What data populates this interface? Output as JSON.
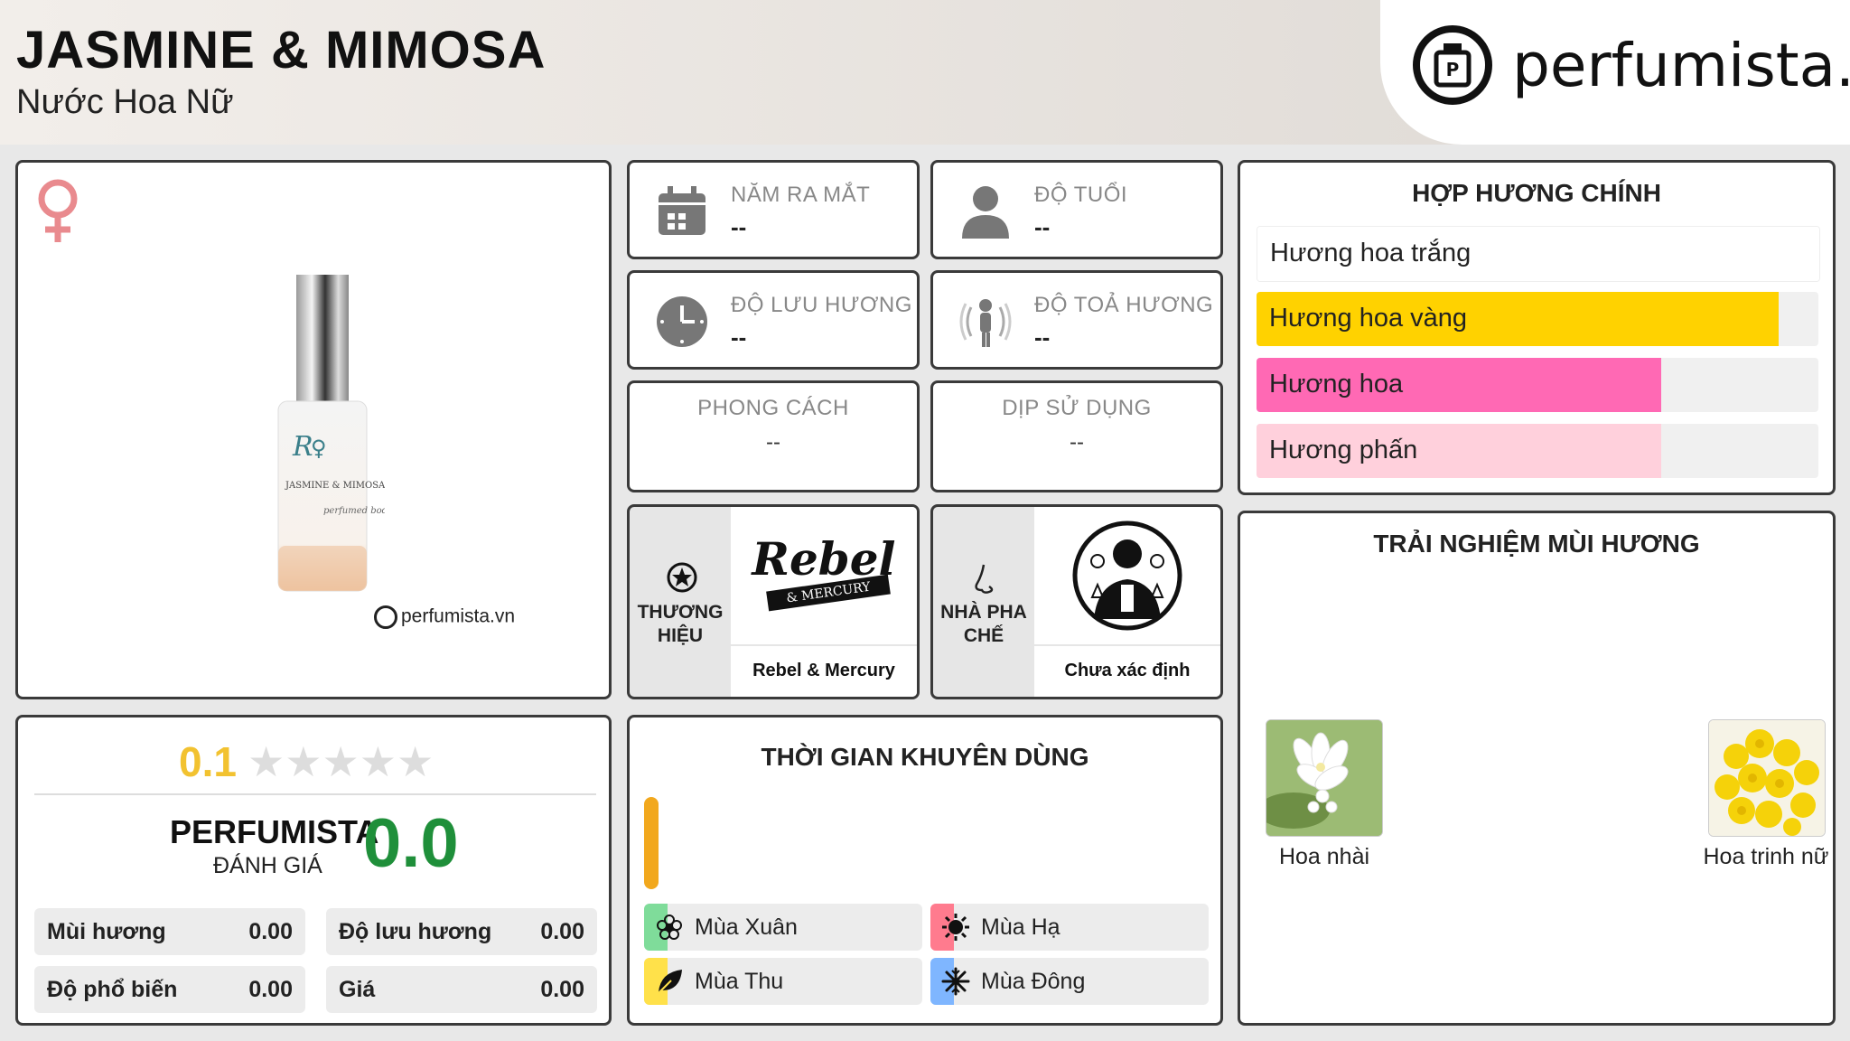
{
  "header": {
    "title": "JASMINE & MIMOSA",
    "subtitle": "Nước Hoa Nữ",
    "logo_text": "perfumista.vn"
  },
  "product": {
    "gender_icon": "female-symbol-icon",
    "watermark": "perfumista.vn",
    "bottle_label_line1": "JASMINE & MIMOSA",
    "bottle_label_line2": "perfumed body"
  },
  "info": {
    "release_year": {
      "label": "NĂM RA MẮT",
      "value": "--"
    },
    "age": {
      "label": "ĐỘ TUỔI",
      "value": "--"
    },
    "longevity": {
      "label": "ĐỘ LƯU HƯƠNG",
      "value": "--"
    },
    "sillage": {
      "label": "ĐỘ TOẢ HƯƠNG",
      "value": "--"
    },
    "style": {
      "label": "PHONG CÁCH",
      "value": "--"
    },
    "occasion": {
      "label": "DỊP SỬ DỤNG",
      "value": "--"
    }
  },
  "brand": {
    "label_line1": "THƯƠNG",
    "label_line2": "HIỆU",
    "name": "Rebel & Mercury",
    "logo_line1": "Rebel",
    "logo_line2": "& MERCURY"
  },
  "perfumer": {
    "label_line1": "NHÀ PHA",
    "label_line2": "CHẾ",
    "name": "Chưa xác định"
  },
  "accords": {
    "title": "HỢP HƯƠNG CHÍNH",
    "items": [
      {
        "label": "Hương hoa trắng",
        "level": 1.0,
        "color": "#ffffff"
      },
      {
        "label": "Hương hoa vàng",
        "level": 0.93,
        "color": "#ffd200"
      },
      {
        "label": "Hương hoa",
        "level": 0.72,
        "color": "#ff69b4"
      },
      {
        "label": "Hương phấn",
        "level": 0.72,
        "color": "#ffd0dc"
      }
    ]
  },
  "experience": {
    "title": "TRẢI NGHIỆM MÙI HƯƠNG",
    "notes": [
      {
        "label": "Hoa nhài"
      },
      {
        "label": "Hoa trinh nữ"
      }
    ]
  },
  "rating": {
    "user_score": "0.1",
    "stars_filled": 0,
    "perfumista_label": "PERFUMISTA",
    "review_label": "ĐÁNH GIÁ",
    "perfumista_score": "0.0",
    "items": [
      {
        "label": "Mùi hương",
        "value": "0.00"
      },
      {
        "label": "Độ lưu hương",
        "value": "0.00"
      },
      {
        "label": "Độ phổ biến",
        "value": "0.00"
      },
      {
        "label": "Giá",
        "value": "0.00"
      }
    ]
  },
  "recommended": {
    "title": "THỜI GIAN KHUYÊN DÙNG",
    "seasons": [
      {
        "label": "Mùa Xuân",
        "color": "#7fdc9a",
        "icon": "flower-icon"
      },
      {
        "label": "Mùa Hạ",
        "color": "#ff7b8e",
        "icon": "sun-icon"
      },
      {
        "label": "Mùa Thu",
        "color": "#ffe14a",
        "icon": "leaf-icon"
      },
      {
        "label": "Mùa Đông",
        "color": "#7fb6ff",
        "icon": "snowflake-icon"
      }
    ]
  }
}
